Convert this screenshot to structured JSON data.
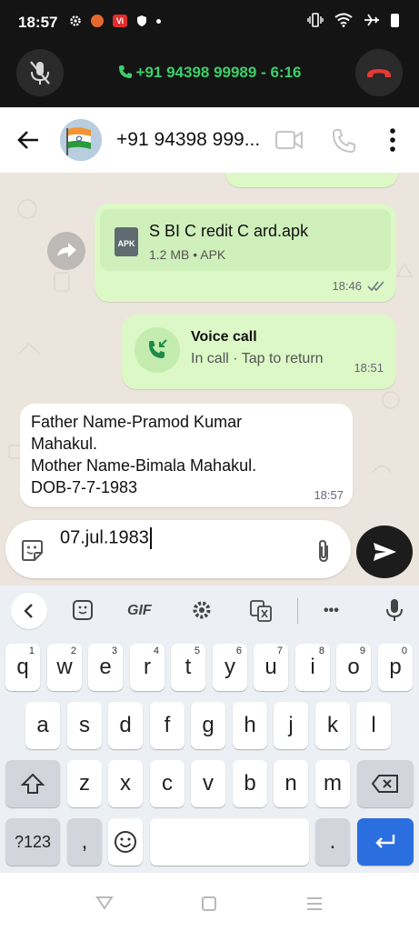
{
  "status_bar": {
    "time": "18:57",
    "left_icons": [
      "gear-icon",
      "app-orange-icon",
      "vi-icon",
      "shield-icon",
      "dot-icon"
    ],
    "vi_label": "Vi",
    "right_icons": [
      "vibrate-icon",
      "wifi-icon",
      "airplane-icon",
      "battery-icon"
    ]
  },
  "call_bar": {
    "call_text": "+91 94398 99989 - 6:16"
  },
  "header": {
    "contact_name": "+91 94398 999..."
  },
  "messages": {
    "file": {
      "icon_label": "APK",
      "name": "S BI  C redit  C ard.apk",
      "meta": "1.2 MB • APK",
      "time": "18:46"
    },
    "voice_call": {
      "title": "Voice call",
      "subtitle": "In call · Tap to return",
      "time": "18:51"
    },
    "text": {
      "lines": [
        "Father Name-Pramod Kumar",
        "Mahakul.",
        "Mother Name-Bimala Mahakul.",
        "DOB-7-7-1983"
      ],
      "time": "18:57"
    }
  },
  "composer": {
    "value": "07.jul.1983"
  },
  "keyboard": {
    "toolbar": {
      "gif_label": "GIF",
      "more_label": "•••"
    },
    "row1": [
      {
        "key": "q",
        "hint": "1"
      },
      {
        "key": "w",
        "hint": "2"
      },
      {
        "key": "e",
        "hint": "3"
      },
      {
        "key": "r",
        "hint": "4"
      },
      {
        "key": "t",
        "hint": "5"
      },
      {
        "key": "y",
        "hint": "6"
      },
      {
        "key": "u",
        "hint": "7"
      },
      {
        "key": "i",
        "hint": "8"
      },
      {
        "key": "o",
        "hint": "9"
      },
      {
        "key": "p",
        "hint": "0"
      }
    ],
    "row2": [
      "a",
      "s",
      "d",
      "f",
      "g",
      "h",
      "j",
      "k",
      "l"
    ],
    "row3": [
      "z",
      "x",
      "c",
      "v",
      "b",
      "n",
      "m"
    ],
    "bottom": {
      "symbols": "?123",
      "comma": ",",
      "period": "."
    }
  },
  "colors": {
    "call_green": "#3ecf6a",
    "end_call_red": "#e53935",
    "outgoing_bubble": "#dcf8c6",
    "enter_key_blue": "#2b6ee0"
  }
}
